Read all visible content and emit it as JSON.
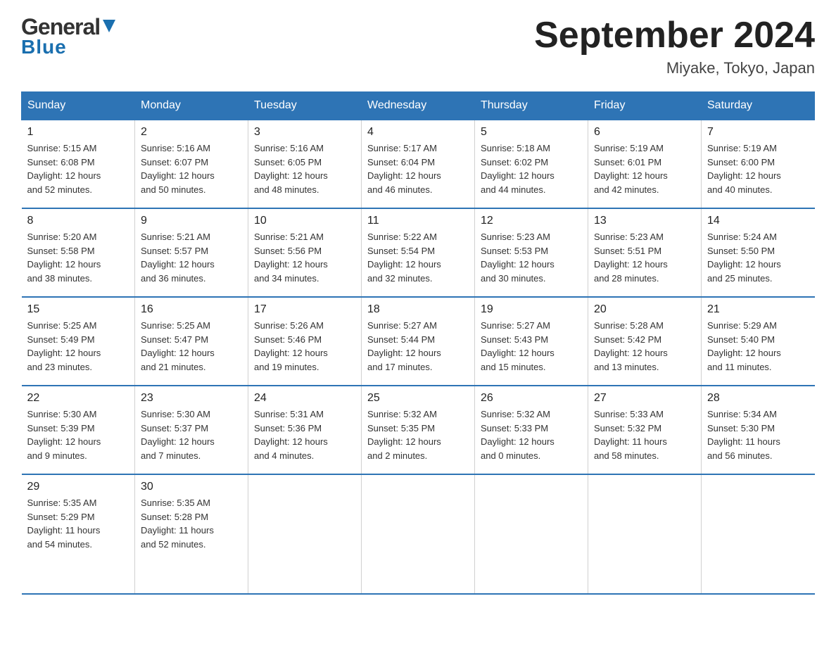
{
  "logo": {
    "general": "General",
    "blue": "Blue",
    "triangle_char": "▼"
  },
  "title": "September 2024",
  "subtitle": "Miyake, Tokyo, Japan",
  "days_header": [
    "Sunday",
    "Monday",
    "Tuesday",
    "Wednesday",
    "Thursday",
    "Friday",
    "Saturday"
  ],
  "weeks": [
    [
      {
        "day": "1",
        "info": "Sunrise: 5:15 AM\nSunset: 6:08 PM\nDaylight: 12 hours\nand 52 minutes."
      },
      {
        "day": "2",
        "info": "Sunrise: 5:16 AM\nSunset: 6:07 PM\nDaylight: 12 hours\nand 50 minutes."
      },
      {
        "day": "3",
        "info": "Sunrise: 5:16 AM\nSunset: 6:05 PM\nDaylight: 12 hours\nand 48 minutes."
      },
      {
        "day": "4",
        "info": "Sunrise: 5:17 AM\nSunset: 6:04 PM\nDaylight: 12 hours\nand 46 minutes."
      },
      {
        "day": "5",
        "info": "Sunrise: 5:18 AM\nSunset: 6:02 PM\nDaylight: 12 hours\nand 44 minutes."
      },
      {
        "day": "6",
        "info": "Sunrise: 5:19 AM\nSunset: 6:01 PM\nDaylight: 12 hours\nand 42 minutes."
      },
      {
        "day": "7",
        "info": "Sunrise: 5:19 AM\nSunset: 6:00 PM\nDaylight: 12 hours\nand 40 minutes."
      }
    ],
    [
      {
        "day": "8",
        "info": "Sunrise: 5:20 AM\nSunset: 5:58 PM\nDaylight: 12 hours\nand 38 minutes."
      },
      {
        "day": "9",
        "info": "Sunrise: 5:21 AM\nSunset: 5:57 PM\nDaylight: 12 hours\nand 36 minutes."
      },
      {
        "day": "10",
        "info": "Sunrise: 5:21 AM\nSunset: 5:56 PM\nDaylight: 12 hours\nand 34 minutes."
      },
      {
        "day": "11",
        "info": "Sunrise: 5:22 AM\nSunset: 5:54 PM\nDaylight: 12 hours\nand 32 minutes."
      },
      {
        "day": "12",
        "info": "Sunrise: 5:23 AM\nSunset: 5:53 PM\nDaylight: 12 hours\nand 30 minutes."
      },
      {
        "day": "13",
        "info": "Sunrise: 5:23 AM\nSunset: 5:51 PM\nDaylight: 12 hours\nand 28 minutes."
      },
      {
        "day": "14",
        "info": "Sunrise: 5:24 AM\nSunset: 5:50 PM\nDaylight: 12 hours\nand 25 minutes."
      }
    ],
    [
      {
        "day": "15",
        "info": "Sunrise: 5:25 AM\nSunset: 5:49 PM\nDaylight: 12 hours\nand 23 minutes."
      },
      {
        "day": "16",
        "info": "Sunrise: 5:25 AM\nSunset: 5:47 PM\nDaylight: 12 hours\nand 21 minutes."
      },
      {
        "day": "17",
        "info": "Sunrise: 5:26 AM\nSunset: 5:46 PM\nDaylight: 12 hours\nand 19 minutes."
      },
      {
        "day": "18",
        "info": "Sunrise: 5:27 AM\nSunset: 5:44 PM\nDaylight: 12 hours\nand 17 minutes."
      },
      {
        "day": "19",
        "info": "Sunrise: 5:27 AM\nSunset: 5:43 PM\nDaylight: 12 hours\nand 15 minutes."
      },
      {
        "day": "20",
        "info": "Sunrise: 5:28 AM\nSunset: 5:42 PM\nDaylight: 12 hours\nand 13 minutes."
      },
      {
        "day": "21",
        "info": "Sunrise: 5:29 AM\nSunset: 5:40 PM\nDaylight: 12 hours\nand 11 minutes."
      }
    ],
    [
      {
        "day": "22",
        "info": "Sunrise: 5:30 AM\nSunset: 5:39 PM\nDaylight: 12 hours\nand 9 minutes."
      },
      {
        "day": "23",
        "info": "Sunrise: 5:30 AM\nSunset: 5:37 PM\nDaylight: 12 hours\nand 7 minutes."
      },
      {
        "day": "24",
        "info": "Sunrise: 5:31 AM\nSunset: 5:36 PM\nDaylight: 12 hours\nand 4 minutes."
      },
      {
        "day": "25",
        "info": "Sunrise: 5:32 AM\nSunset: 5:35 PM\nDaylight: 12 hours\nand 2 minutes."
      },
      {
        "day": "26",
        "info": "Sunrise: 5:32 AM\nSunset: 5:33 PM\nDaylight: 12 hours\nand 0 minutes."
      },
      {
        "day": "27",
        "info": "Sunrise: 5:33 AM\nSunset: 5:32 PM\nDaylight: 11 hours\nand 58 minutes."
      },
      {
        "day": "28",
        "info": "Sunrise: 5:34 AM\nSunset: 5:30 PM\nDaylight: 11 hours\nand 56 minutes."
      }
    ],
    [
      {
        "day": "29",
        "info": "Sunrise: 5:35 AM\nSunset: 5:29 PM\nDaylight: 11 hours\nand 54 minutes."
      },
      {
        "day": "30",
        "info": "Sunrise: 5:35 AM\nSunset: 5:28 PM\nDaylight: 11 hours\nand 52 minutes."
      },
      {
        "day": "",
        "info": ""
      },
      {
        "day": "",
        "info": ""
      },
      {
        "day": "",
        "info": ""
      },
      {
        "day": "",
        "info": ""
      },
      {
        "day": "",
        "info": ""
      }
    ]
  ]
}
